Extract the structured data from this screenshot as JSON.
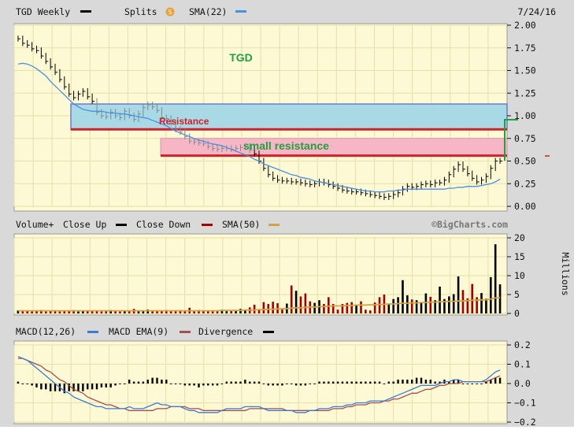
{
  "header": {
    "title": "TGD Weekly",
    "splits_label": "Splits",
    "splits_icon": "splits-coin-icon",
    "sma_label": "SMA(22)",
    "date": "7/24/16",
    "watermark": "©BigCharts.com"
  },
  "colors": {
    "panel_bg": "#fcf9d4",
    "grid": "#e6dfa9",
    "price_bar": "#000000",
    "sma22": "#4a90e2",
    "vol_up": "#000000",
    "vol_down": "#a00000",
    "sma50": "#d4a04a",
    "macd": "#3a7bd5",
    "macd_ema": "#a05050",
    "divergence": "#000000",
    "resistance_box": "#a8d9e4",
    "small_resistance_box": "#f6b6c6",
    "resistance_line": "#d0202a",
    "annotation_green": "#20a040"
  },
  "annotations": {
    "ticker_label": "TGD",
    "resistance_label": "Resistance",
    "small_resistance_label": "small resistance"
  },
  "volume_header": {
    "volume_label": "Volume+",
    "close_up_label": "Close Up",
    "close_down_label": "Close Down",
    "sma_label": "SMA(50)",
    "unit_label": "Millions"
  },
  "macd_header": {
    "macd_label": "MACD(12,26)",
    "ema_label": "MACD EMA(9)",
    "divergence_label": "Divergence"
  },
  "chart_data": [
    {
      "type": "line",
      "panel": "price",
      "ylim": [
        0,
        2.0
      ],
      "yticks": [
        "2.00",
        "1.75",
        "1.50",
        "1.25",
        "1.00",
        "0.75",
        "0.50",
        "0.25",
        "0.00"
      ],
      "n_weeks": 105,
      "series": [
        {
          "name": "TGD Weekly",
          "values": [
            1.85,
            1.8,
            1.78,
            1.74,
            1.72,
            1.66,
            1.6,
            1.54,
            1.48,
            1.4,
            1.32,
            1.24,
            1.2,
            1.24,
            1.27,
            1.21,
            1.16,
            1.04,
            1.0,
            0.99,
            1.04,
            1.0,
            0.98,
            1.05,
            1.0,
            0.96,
            1.02,
            1.09,
            1.12,
            1.1,
            1.06,
            0.98,
            0.97,
            0.92,
            0.85,
            0.82,
            0.77,
            0.72,
            0.71,
            0.7,
            0.69,
            0.66,
            0.64,
            0.63,
            0.64,
            0.64,
            0.63,
            0.64,
            0.65,
            0.66,
            0.62,
            0.58,
            0.5,
            0.42,
            0.35,
            0.31,
            0.29,
            0.28,
            0.28,
            0.27,
            0.27,
            0.26,
            0.25,
            0.24,
            0.25,
            0.27,
            0.26,
            0.24,
            0.22,
            0.2,
            0.18,
            0.17,
            0.16,
            0.16,
            0.15,
            0.14,
            0.13,
            0.12,
            0.11,
            0.1,
            0.11,
            0.13,
            0.15,
            0.19,
            0.22,
            0.21,
            0.22,
            0.24,
            0.25,
            0.24,
            0.26,
            0.26,
            0.29,
            0.35,
            0.41,
            0.46,
            0.41,
            0.36,
            0.31,
            0.27,
            0.29,
            0.33,
            0.42,
            0.5,
            0.5
          ]
        },
        {
          "name": "SMA(22)",
          "values": [
            1.57,
            1.58,
            1.57,
            1.55,
            1.52,
            1.48,
            1.44,
            1.38,
            1.33,
            1.28,
            1.23,
            1.18,
            1.13,
            1.1,
            1.07,
            1.06,
            1.05,
            1.05,
            1.05,
            1.04,
            1.03,
            1.03,
            1.02,
            1.02,
            1.01,
            1.0,
            0.99,
            0.98,
            0.97,
            0.95,
            0.93,
            0.91,
            0.89,
            0.86,
            0.83,
            0.81,
            0.79,
            0.77,
            0.75,
            0.73,
            0.72,
            0.7,
            0.69,
            0.68,
            0.67,
            0.65,
            0.63,
            0.61,
            0.59,
            0.57,
            0.55,
            0.52,
            0.5,
            0.47,
            0.45,
            0.43,
            0.41,
            0.39,
            0.37,
            0.35,
            0.34,
            0.32,
            0.31,
            0.3,
            0.28,
            0.27,
            0.26,
            0.25,
            0.24,
            0.23,
            0.22,
            0.21,
            0.2,
            0.19,
            0.18,
            0.17,
            0.17,
            0.16,
            0.16,
            0.16,
            0.17,
            0.17,
            0.18,
            0.18,
            0.19,
            0.19,
            0.19,
            0.19,
            0.19,
            0.19,
            0.19,
            0.19,
            0.19,
            0.2,
            0.2,
            0.21,
            0.21,
            0.22,
            0.22,
            0.22,
            0.23,
            0.24,
            0.25,
            0.27,
            0.3
          ]
        }
      ],
      "bands": [
        {
          "label": "Resistance",
          "from": 0.85,
          "to": 1.13
        },
        {
          "label": "small resistance",
          "from": 0.56,
          "to": 0.75
        }
      ]
    },
    {
      "type": "bar",
      "panel": "volume",
      "ylim": [
        0,
        20
      ],
      "yticks": [
        "20",
        "15",
        "10",
        "5",
        "0"
      ],
      "ylabel": "Millions",
      "values": [
        0.8,
        0.6,
        0.7,
        0.5,
        0.6,
        0.9,
        0.5,
        0.6,
        0.7,
        0.5,
        0.8,
        0.6,
        0.9,
        0.5,
        0.7,
        0.6,
        0.8,
        0.7,
        0.5,
        0.6,
        0.9,
        0.6,
        0.5,
        0.7,
        0.8,
        1.2,
        0.6,
        0.7,
        1.0,
        0.6,
        0.8,
        0.7,
        0.9,
        0.6,
        0.8,
        0.9,
        0.6,
        1.5,
        0.7,
        0.9,
        0.8,
        0.6,
        0.7,
        0.8,
        1.0,
        0.6,
        0.9,
        0.8,
        1.2,
        0.8,
        1.6,
        2.3,
        1.1,
        3.0,
        2.5,
        3.1,
        2.7,
        1.1,
        2.6,
        7.4,
        6.0,
        4.5,
        5.3,
        3.2,
        2.8,
        3.5,
        2.5,
        4.3,
        2.5,
        1.0,
        2.5,
        2.8,
        3.0,
        2.3,
        3.2,
        1.0,
        0.8,
        2.9,
        4.3,
        5.0,
        2.6,
        3.8,
        4.3,
        8.8,
        4.8,
        3.7,
        3.5,
        2.8,
        5.3,
        4.4,
        3.5,
        7.1,
        3.8,
        4.5,
        5.1,
        9.8,
        6.2,
        4.0,
        7.8,
        4.3,
        5.4,
        3.9,
        9.6,
        18.3,
        7.7
      ],
      "up_down": "rule:close_vs_previous",
      "series": [
        {
          "name": "SMA(50)",
          "values": [
            0.7,
            0.7,
            0.7,
            0.7,
            0.7,
            0.7,
            0.7,
            0.7,
            0.7,
            0.7,
            0.7,
            0.7,
            0.7,
            0.7,
            0.7,
            0.7,
            0.7,
            0.7,
            0.7,
            0.7,
            0.7,
            0.7,
            0.7,
            0.7,
            0.7,
            0.7,
            0.7,
            0.7,
            0.7,
            0.7,
            0.7,
            0.7,
            0.7,
            0.7,
            0.7,
            0.7,
            0.7,
            0.7,
            0.7,
            0.7,
            0.7,
            0.7,
            0.7,
            0.7,
            0.8,
            0.8,
            0.8,
            0.8,
            0.8,
            0.9,
            0.9,
            0.9,
            1.0,
            1.0,
            1.1,
            1.1,
            1.2,
            1.2,
            1.3,
            1.4,
            1.5,
            1.5,
            1.6,
            1.7,
            1.7,
            1.8,
            1.8,
            1.9,
            2.0,
            2.0,
            2.0,
            2.1,
            2.1,
            2.2,
            2.2,
            2.2,
            2.3,
            2.3,
            2.4,
            2.4,
            2.5,
            2.5,
            2.6,
            2.7,
            2.7,
            2.8,
            2.8,
            2.9,
            2.9,
            3.0,
            3.0,
            3.1,
            3.1,
            3.2,
            3.2,
            3.3,
            3.3,
            3.4,
            3.5,
            3.5,
            3.6,
            3.6,
            3.8,
            4.1,
            4.2
          ]
        }
      ]
    },
    {
      "type": "line",
      "panel": "macd",
      "ylim": [
        -0.2,
        0.2
      ],
      "yticks": [
        "0.2",
        "0.1",
        "0.0",
        "−0.1",
        "−0.2"
      ],
      "series": [
        {
          "name": "MACD(12,26)",
          "values": [
            0.14,
            0.13,
            0.12,
            0.1,
            0.08,
            0.06,
            0.04,
            0.02,
            0.0,
            -0.02,
            -0.04,
            -0.05,
            -0.07,
            -0.08,
            -0.09,
            -0.1,
            -0.11,
            -0.12,
            -0.12,
            -0.13,
            -0.13,
            -0.13,
            -0.13,
            -0.13,
            -0.12,
            -0.13,
            -0.13,
            -0.13,
            -0.12,
            -0.11,
            -0.1,
            -0.11,
            -0.11,
            -0.12,
            -0.12,
            -0.12,
            -0.13,
            -0.14,
            -0.14,
            -0.15,
            -0.15,
            -0.15,
            -0.15,
            -0.15,
            -0.14,
            -0.13,
            -0.13,
            -0.13,
            -0.13,
            -0.12,
            -0.12,
            -0.12,
            -0.12,
            -0.13,
            -0.14,
            -0.14,
            -0.14,
            -0.14,
            -0.14,
            -0.14,
            -0.15,
            -0.15,
            -0.15,
            -0.14,
            -0.14,
            -0.13,
            -0.13,
            -0.13,
            -0.12,
            -0.12,
            -0.12,
            -0.11,
            -0.11,
            -0.1,
            -0.1,
            -0.1,
            -0.09,
            -0.09,
            -0.09,
            -0.09,
            -0.08,
            -0.07,
            -0.06,
            -0.05,
            -0.04,
            -0.03,
            -0.02,
            -0.01,
            -0.01,
            -0.01,
            -0.01,
            0.0,
            0.01,
            0.01,
            0.02,
            0.02,
            0.01,
            0.01,
            0.01,
            0.01,
            0.01,
            0.02,
            0.04,
            0.06,
            0.07
          ]
        },
        {
          "name": "MACD EMA(9)",
          "values": [
            0.13,
            0.13,
            0.12,
            0.11,
            0.1,
            0.09,
            0.07,
            0.06,
            0.04,
            0.02,
            0.01,
            -0.01,
            -0.03,
            -0.04,
            -0.05,
            -0.07,
            -0.08,
            -0.09,
            -0.1,
            -0.11,
            -0.11,
            -0.12,
            -0.13,
            -0.13,
            -0.14,
            -0.14,
            -0.14,
            -0.14,
            -0.14,
            -0.14,
            -0.13,
            -0.13,
            -0.13,
            -0.12,
            -0.12,
            -0.12,
            -0.12,
            -0.13,
            -0.13,
            -0.13,
            -0.14,
            -0.14,
            -0.14,
            -0.14,
            -0.14,
            -0.14,
            -0.14,
            -0.14,
            -0.14,
            -0.14,
            -0.13,
            -0.13,
            -0.13,
            -0.13,
            -0.13,
            -0.13,
            -0.13,
            -0.13,
            -0.14,
            -0.14,
            -0.14,
            -0.14,
            -0.14,
            -0.14,
            -0.14,
            -0.14,
            -0.14,
            -0.14,
            -0.13,
            -0.13,
            -0.13,
            -0.12,
            -0.12,
            -0.11,
            -0.11,
            -0.11,
            -0.1,
            -0.1,
            -0.1,
            -0.09,
            -0.09,
            -0.08,
            -0.08,
            -0.07,
            -0.06,
            -0.05,
            -0.05,
            -0.04,
            -0.03,
            -0.03,
            -0.02,
            -0.01,
            -0.01,
            0.0,
            0.0,
            0.0,
            0.01,
            0.01,
            0.01,
            0.01,
            0.01,
            0.01,
            0.02,
            0.03,
            0.04
          ]
        }
      ],
      "divergence": [
        0.01,
        0.0,
        0.0,
        -0.01,
        -0.02,
        -0.03,
        -0.03,
        -0.04,
        -0.04,
        -0.04,
        -0.05,
        -0.04,
        -0.04,
        -0.04,
        -0.04,
        -0.03,
        -0.03,
        -0.03,
        -0.02,
        -0.02,
        -0.02,
        -0.01,
        0.0,
        0.0,
        0.02,
        0.01,
        0.01,
        0.01,
        0.02,
        0.03,
        0.03,
        0.02,
        0.02,
        0.0,
        0.0,
        0.0,
        -0.01,
        -0.01,
        -0.01,
        -0.02,
        -0.01,
        -0.01,
        -0.01,
        -0.01,
        0.0,
        0.01,
        0.01,
        0.01,
        0.01,
        0.02,
        0.01,
        0.01,
        0.01,
        0.0,
        -0.01,
        -0.01,
        -0.01,
        -0.01,
        0.0,
        0.0,
        -0.01,
        -0.01,
        -0.01,
        0.0,
        0.0,
        0.01,
        0.01,
        0.01,
        0.01,
        0.01,
        0.01,
        0.01,
        0.01,
        0.01,
        0.01,
        0.01,
        0.01,
        0.01,
        0.01,
        0.0,
        0.01,
        0.01,
        0.02,
        0.02,
        0.02,
        0.02,
        0.03,
        0.03,
        0.02,
        0.02,
        0.01,
        0.01,
        0.02,
        0.01,
        0.02,
        0.02,
        0.0,
        0.0,
        0.0,
        0.0,
        0.0,
        0.01,
        0.02,
        0.03,
        0.03
      ]
    }
  ]
}
